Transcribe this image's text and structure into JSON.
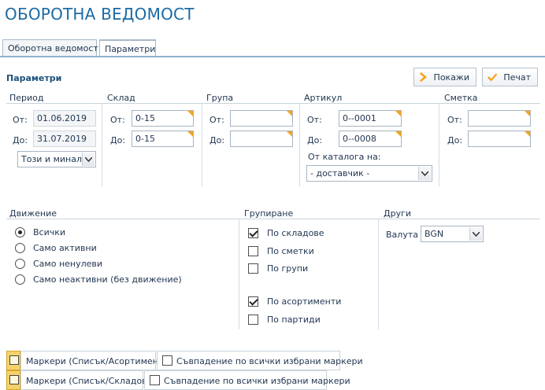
{
  "page": {
    "title": "ОБОРОТНА ВЕДОМОСТ"
  },
  "tabs": [
    {
      "label": "Оборотна ведомост",
      "active": false
    },
    {
      "label": "Параметри",
      "active": true
    }
  ],
  "section": {
    "title": "Параметри"
  },
  "toolbar": {
    "show_label": "Покажи",
    "print_label": "Печат"
  },
  "period": {
    "label": "Период",
    "from_label": "От:",
    "from_value": "01.06.2019",
    "to_label": "До:",
    "to_value": "31.07.2019",
    "preset_value": "Този и миналия"
  },
  "warehouse": {
    "label": "Склад",
    "from_label": "От:",
    "from_value": "0-15",
    "to_label": "До:",
    "to_value": "0-15"
  },
  "group": {
    "label": "Група",
    "from_label": "От:",
    "from_value": "",
    "to_label": "До:",
    "to_value": ""
  },
  "article": {
    "label": "Артикул",
    "from_label": "От:",
    "from_value": "0--0001",
    "to_label": "До:",
    "to_value": "0--0008",
    "catalog_label": "От каталога на:",
    "catalog_value": "- доставчик -"
  },
  "account": {
    "label": "Сметка",
    "from_label": "От:",
    "from_value": "",
    "to_label": "До:",
    "to_value": ""
  },
  "movement": {
    "label": "Движение",
    "options": [
      {
        "label": "Всички",
        "selected": true
      },
      {
        "label": "Само активни",
        "selected": false
      },
      {
        "label": "Само ненулеви",
        "selected": false
      },
      {
        "label": "Само неактивни (без движение)",
        "selected": false
      }
    ]
  },
  "grouping": {
    "label": "Групиране",
    "options": [
      {
        "label": "По складове",
        "checked": true
      },
      {
        "label": "По сметки",
        "checked": false
      },
      {
        "label": "По групи",
        "checked": false
      },
      {
        "label": "По асортименти",
        "checked": true
      },
      {
        "label": "По партиди",
        "checked": false
      }
    ]
  },
  "other": {
    "label": "Други",
    "currency_label": "Валута",
    "currency_value": "BGN"
  },
  "markers": [
    {
      "label": "Маркери (Списък/Асортименти)",
      "match_label": "Съвпадение по всички избрани маркери"
    },
    {
      "label": "Маркери (Списък/Складове)",
      "match_label": "Съвпадение по всички избрани маркери"
    }
  ],
  "colors": {
    "accent": "#f5a51c",
    "title": "#1b6aa5",
    "text": "#1f3550"
  }
}
